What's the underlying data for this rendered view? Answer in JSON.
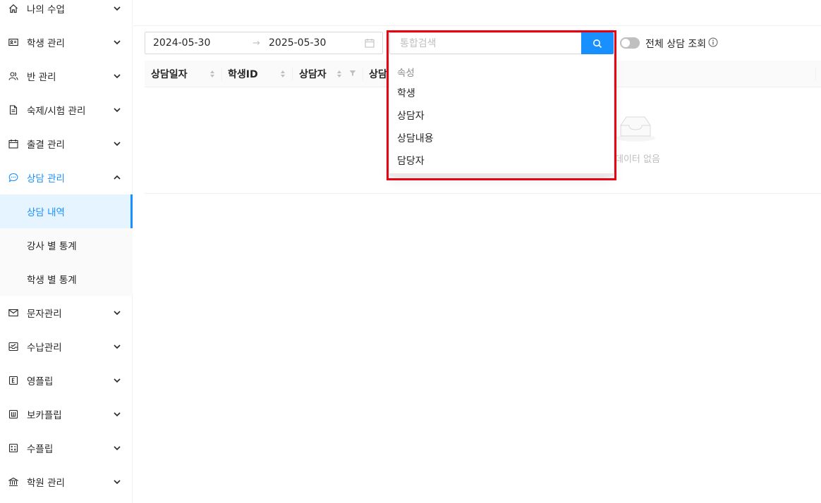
{
  "sidebar": {
    "items": [
      {
        "label": "나의 수업",
        "icon": "home-icon"
      },
      {
        "label": "학생 관리",
        "icon": "id-card-icon"
      },
      {
        "label": "반 관리",
        "icon": "users-icon"
      },
      {
        "label": "숙제/시험 관리",
        "icon": "file-icon"
      },
      {
        "label": "출결 관리",
        "icon": "calendar-icon"
      },
      {
        "label": "상담 관리",
        "icon": "chat-icon"
      },
      {
        "label": "문자관리",
        "icon": "mail-icon"
      },
      {
        "label": "수납관리",
        "icon": "inbox-icon"
      },
      {
        "label": "영플립",
        "icon": "letter-e-icon"
      },
      {
        "label": "보카플립",
        "icon": "letter-w-icon"
      },
      {
        "label": "수플립",
        "icon": "calculator-icon"
      },
      {
        "label": "학원 관리",
        "icon": "bank-icon"
      }
    ],
    "submenu": [
      {
        "label": "상담 내역"
      },
      {
        "label": "강사 별 통계"
      },
      {
        "label": "학생 별 통계"
      }
    ]
  },
  "filters": {
    "date_start": "2024-05-30",
    "date_separator": "→",
    "date_end": "2025-05-30",
    "search_placeholder": "통합검색",
    "toggle_label": "전체 상담 조회"
  },
  "table": {
    "columns": [
      "상담일자",
      "학생ID",
      "상담자",
      "상담"
    ],
    "empty_text": "데이터 없음"
  },
  "dropdown": {
    "group_label": "속성",
    "options": [
      "학생",
      "상담자",
      "상담내용",
      "담당자"
    ]
  },
  "colors": {
    "accent": "#1890ff",
    "highlight": "#e60012"
  }
}
